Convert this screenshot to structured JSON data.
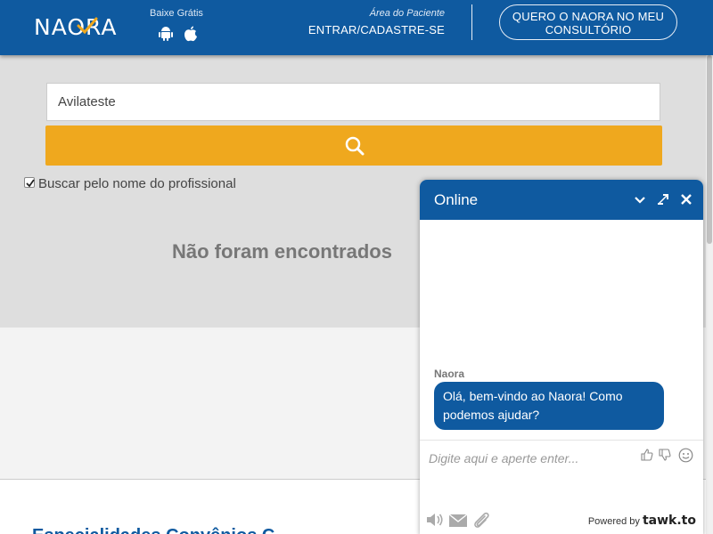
{
  "header": {
    "logo_text": "NAORA",
    "store_label": "Baixe Grátis",
    "patient_sub": "Área do Paciente",
    "patient_link": "ENTRAR/CADASTRE-SE",
    "cta_line1": "QUERO O NAORA NO MEU",
    "cta_line2": "CONSULTÓRIO"
  },
  "search": {
    "input_value": "Avilateste",
    "checkbox_label": "Buscar pelo nome do profissional",
    "checkbox_checked": true,
    "no_results": "Não foram encontrados"
  },
  "footer": {
    "heading": "Especialidades     Convênios          C"
  },
  "chat": {
    "status": "Online",
    "agent_name": "Naora",
    "message": "Olá, bem-vindo ao Naora! Como podemos ajudar?",
    "input_placeholder": "Digite aqui e aperte enter...",
    "powered_label": "Powered by",
    "powered_brand": "tawk.to"
  },
  "colors": {
    "brand_blue": "#0f5aa0",
    "search_button": "#efa81e",
    "page_gray": "#dedede"
  },
  "icons": [
    "android-icon",
    "apple-icon",
    "search-icon",
    "chevron-down-icon",
    "popout-icon",
    "close-icon",
    "thumbs-up-icon",
    "thumbs-down-icon",
    "emoji-icon",
    "sound-icon",
    "mail-icon",
    "attach-icon"
  ]
}
